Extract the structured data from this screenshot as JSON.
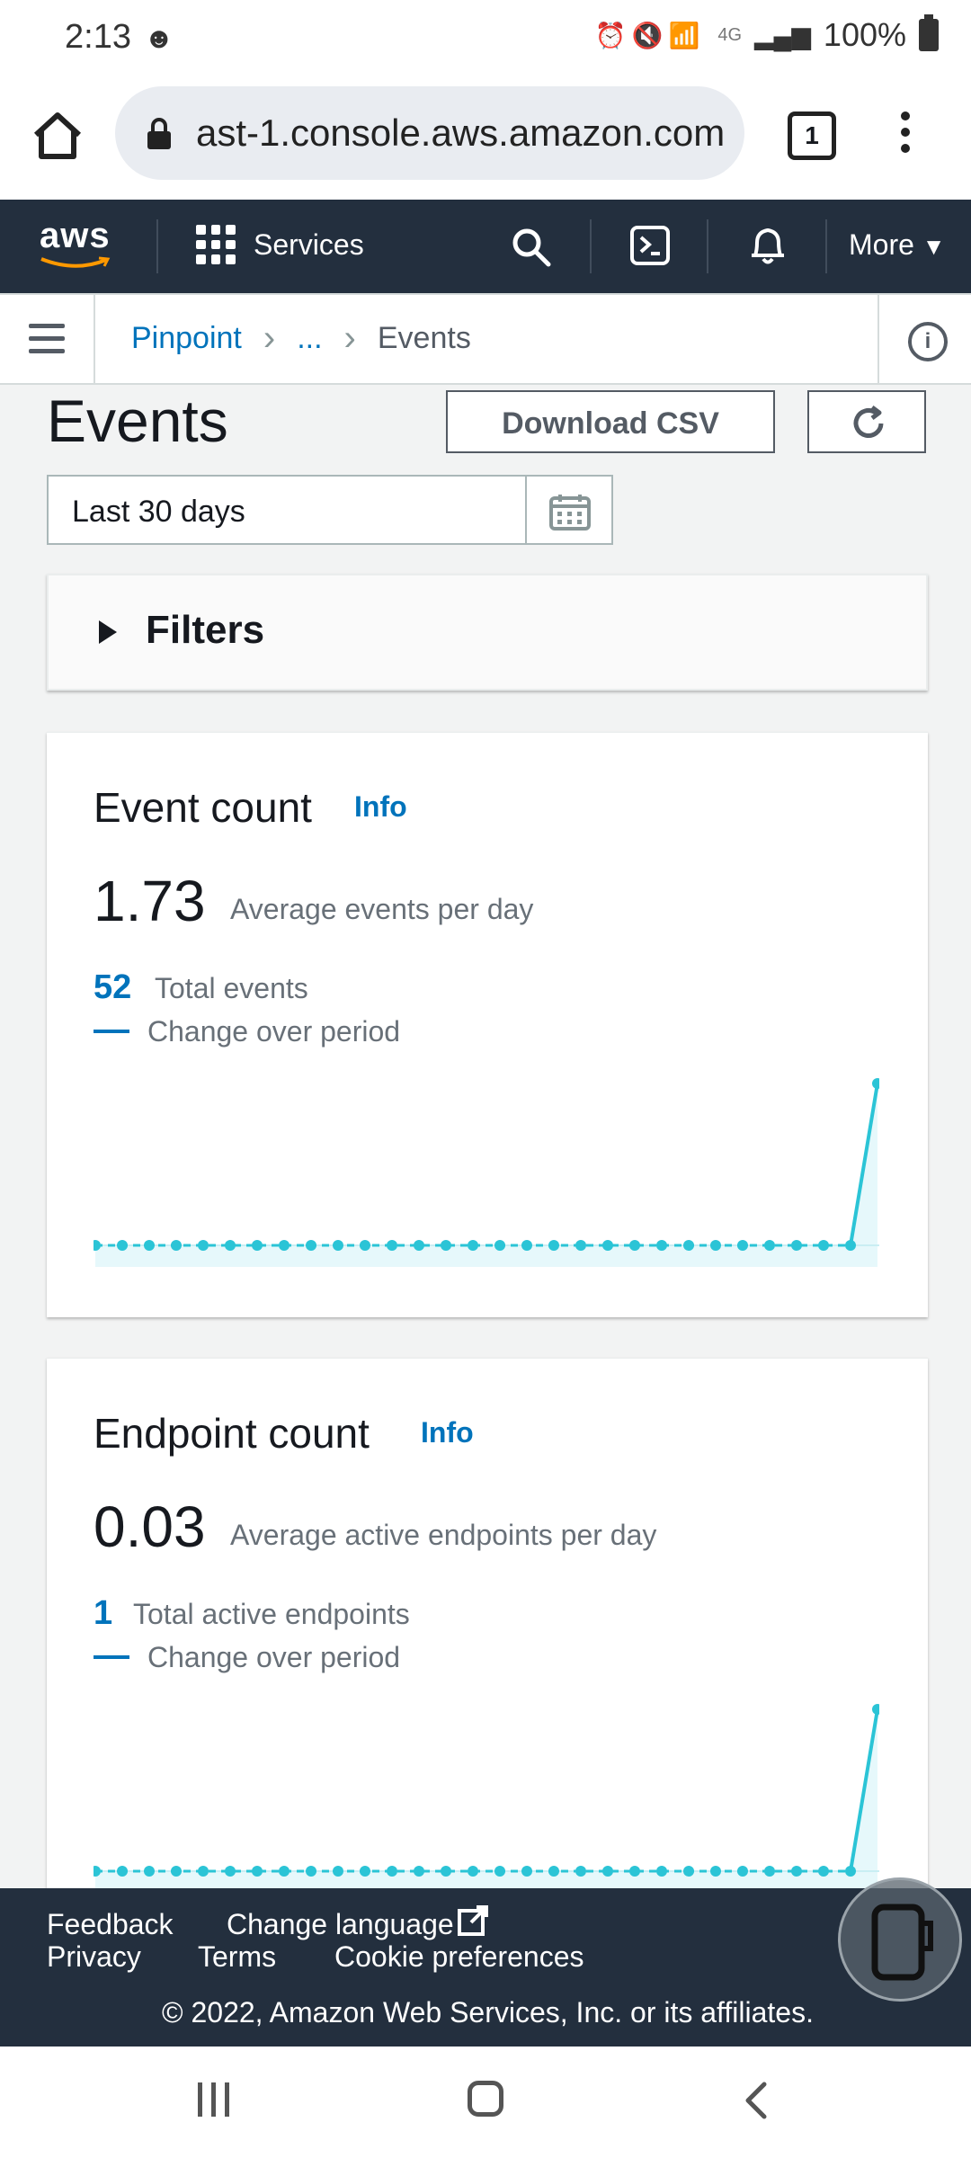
{
  "status_bar": {
    "time": "2:13",
    "network": "4G",
    "battery": "100%"
  },
  "browser": {
    "url": "ast-1.console.aws.amazon.com",
    "tab_count": "1"
  },
  "aws_nav": {
    "logo": "aws",
    "services_label": "Services",
    "more_label": "More"
  },
  "breadcrumb": {
    "items": [
      "Pinpoint",
      "...",
      "Events"
    ]
  },
  "page": {
    "title": "Events",
    "download_label": "Download CSV",
    "date_range": "Last 30 days",
    "filters_label": "Filters"
  },
  "event_card": {
    "title": "Event count",
    "info": "Info",
    "avg_value": "1.73",
    "avg_desc": "Average events per day",
    "total_value": "52",
    "total_desc": "Total events",
    "change_desc": "Change over period"
  },
  "endpoint_card": {
    "title": "Endpoint count",
    "info": "Info",
    "avg_value": "0.03",
    "avg_desc": "Average active endpoints per day",
    "total_value": "1",
    "total_desc": "Total active endpoints",
    "change_desc": "Change over period"
  },
  "chart_data": [
    {
      "type": "line",
      "series": [
        {
          "values": [
            0,
            0,
            0,
            0,
            0,
            0,
            0,
            0,
            0,
            0,
            0,
            0,
            0,
            0,
            0,
            0,
            0,
            0,
            0,
            0,
            0,
            0,
            0,
            0,
            0,
            0,
            0,
            0,
            0,
            52
          ]
        }
      ]
    },
    {
      "type": "line",
      "series": [
        {
          "values": [
            0,
            0,
            0,
            0,
            0,
            0,
            0,
            0,
            0,
            0,
            0,
            0,
            0,
            0,
            0,
            0,
            0,
            0,
            0,
            0,
            0,
            0,
            0,
            0,
            0,
            0,
            0,
            0,
            0,
            1
          ]
        }
      ]
    }
  ],
  "footer": {
    "feedback": "Feedback",
    "change_language": "Change language",
    "privacy": "Privacy",
    "terms": "Terms",
    "cookie_preferences": "Cookie preferences",
    "copyright": "© 2022, Amazon Web Services, Inc. or its affiliates."
  },
  "colors": {
    "nav_bg": "#232f3e",
    "link": "#0073bb",
    "chart_line": "#2bc4d6",
    "chart_fill": "#e6f8fb"
  }
}
